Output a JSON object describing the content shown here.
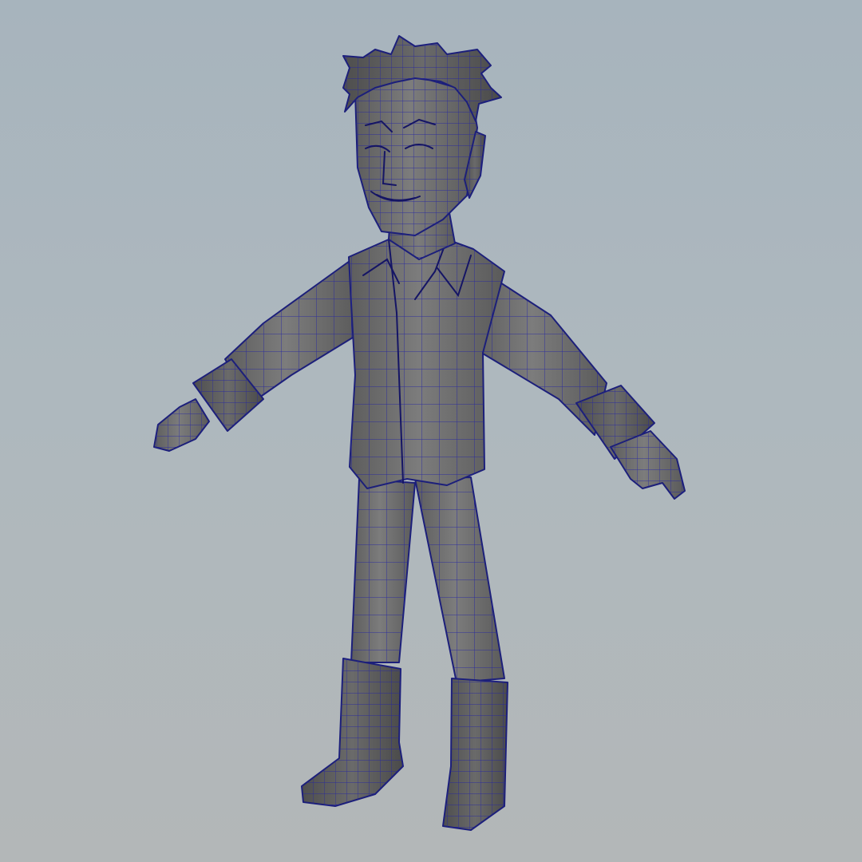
{
  "viewport": {
    "background_top": "#a7b4bd",
    "background_bottom": "#b3b7b8",
    "mesh_fill": "#737373",
    "wire_color": "#1c1f7a"
  },
  "model": {
    "icon": "character-model-icon",
    "pose": "T-pose",
    "display_mode": "wireframe-on-shaded"
  }
}
